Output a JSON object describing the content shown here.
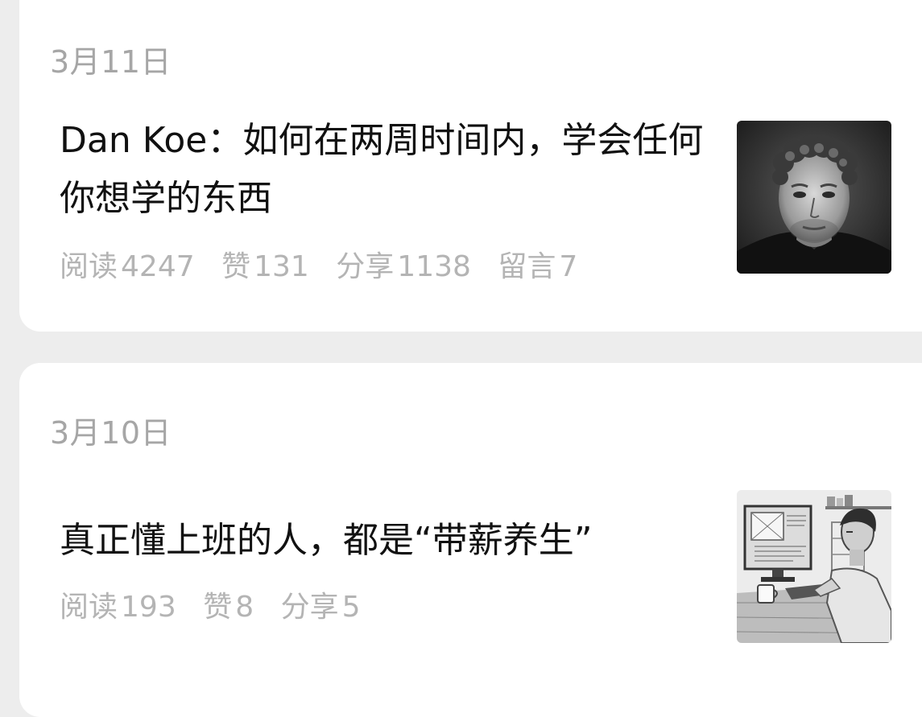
{
  "articles": [
    {
      "date": "3月11日",
      "title": "Dan Koe：如何在两周时间内，学会任何你想学的东西",
      "stats": [
        {
          "label": "阅读",
          "value": "4247"
        },
        {
          "label": "赞",
          "value": "131"
        },
        {
          "label": "分享",
          "value": "1138"
        },
        {
          "label": "留言",
          "value": "7"
        }
      ],
      "thumbnail_icon": "portrait-photo"
    },
    {
      "date": "3月10日",
      "title": "真正懂上班的人，都是“带薪养生”",
      "stats": [
        {
          "label": "阅读",
          "value": "193"
        },
        {
          "label": "赞",
          "value": "8"
        },
        {
          "label": "分享",
          "value": "5"
        }
      ],
      "thumbnail_icon": "office-worker-illustration"
    }
  ]
}
